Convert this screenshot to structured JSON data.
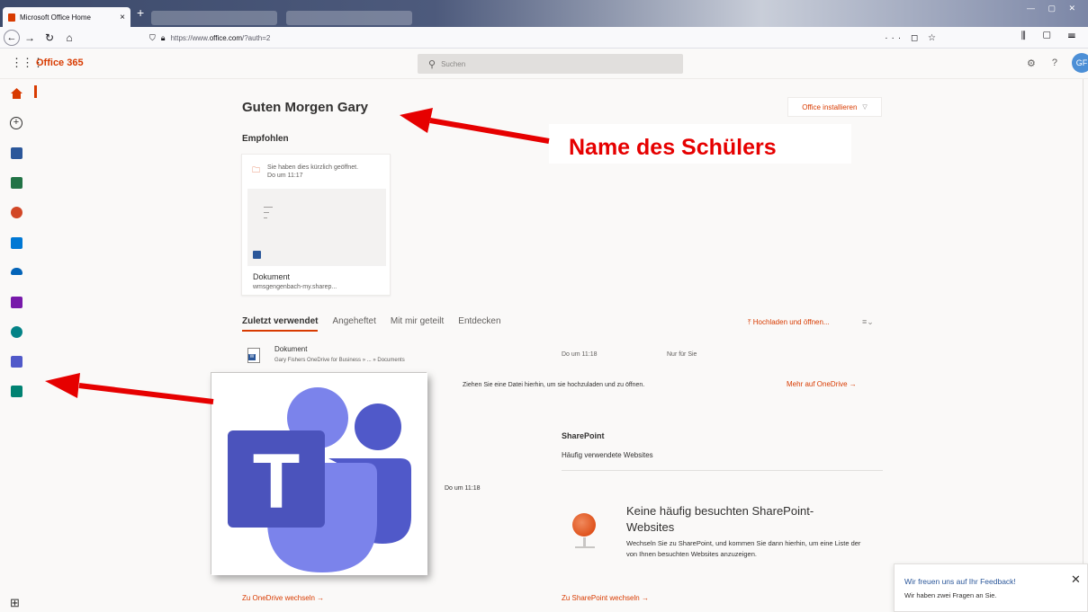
{
  "browser": {
    "tab_title": "Microsoft Office Home",
    "tab_close": "×",
    "new_tab": "+",
    "url_prefix": "https://www.",
    "url_host": "office.com",
    "url_path": "/?auth=2",
    "url_right_icons": "··· ◻ ☆",
    "nav_right_icons": "⫼ ▢ ☰"
  },
  "header": {
    "waffle_icon": "apps-grid-icon",
    "brand": "Office 365",
    "search_placeholder": "Suchen",
    "settings_icon": "gear-icon",
    "help": "?",
    "avatar_initials": "GF"
  },
  "rail": {
    "items": [
      {
        "name": "home",
        "color": "#d83b01"
      },
      {
        "name": "create"
      },
      {
        "name": "word",
        "color": "#2b579a"
      },
      {
        "name": "excel",
        "color": "#217346"
      },
      {
        "name": "powerpoint",
        "color": "#d24726"
      },
      {
        "name": "outlook",
        "color": "#0078d4"
      },
      {
        "name": "onedrive",
        "color": "#0364b8"
      },
      {
        "name": "onenote",
        "color": "#7719aa"
      },
      {
        "name": "sharepoint",
        "color": "#038387"
      },
      {
        "name": "teams",
        "color": "#5059c9"
      },
      {
        "name": "sway",
        "color": "#008272"
      },
      {
        "name": "all-apps"
      }
    ]
  },
  "main": {
    "greeting": "Guten Morgen Gary",
    "install_button": "Office installieren",
    "recommended_heading": "Empfohlen",
    "card": {
      "opened_line1": "Sie haben dies kürzlich geöffnet.",
      "opened_line2": "Do um 11:17",
      "name": "Dokument",
      "location": "wmsgengenbach-my.sharep..."
    },
    "tabs": [
      {
        "label": "Zuletzt verwendet",
        "active": true
      },
      {
        "label": "Angeheftet",
        "active": false
      },
      {
        "label": "Mit mir geteilt",
        "active": false
      },
      {
        "label": "Entdecken",
        "active": false
      }
    ],
    "upload": "Hochladen und öffnen...",
    "recent_file": {
      "name": "Dokument",
      "path": "Gary Fishers OneDrive for Business » ... » Documents",
      "date": "Do um 11:18",
      "sharing": "Nur für Sie"
    },
    "dropzone_text": "Ziehen Sie eine Datei hierhin, um sie hochzuladen und zu öffnen.",
    "more_onedrive": "Mehr auf OneDrive →",
    "onedrive_date": "Do um 11:18",
    "sharepoint": {
      "title": "SharePoint",
      "subtitle": "Häufig verwendete Websites",
      "empty_title": "Keine häufig besuchten SharePoint-Websites",
      "empty_desc": "Wechseln Sie zu SharePoint, und kommen Sie dann hierhin, um eine Liste der von Ihnen besuchten Websites anzuzeigen."
    },
    "to_onedrive": "Zu OneDrive wechseln →",
    "to_sharepoint": "Zu SharePoint wechseln →"
  },
  "feedback": {
    "title": "Wir freuen uns auf Ihr Feedback!",
    "subtitle": "Wir haben zwei Fragen an Sie.",
    "close": "✕"
  },
  "annotation": {
    "label": "Name des Schülers",
    "color": "#e60000"
  },
  "teams_logo": {
    "dark": "#4b53bc",
    "mid": "#5059c9",
    "light": "#7b83eb",
    "letter": "T"
  }
}
